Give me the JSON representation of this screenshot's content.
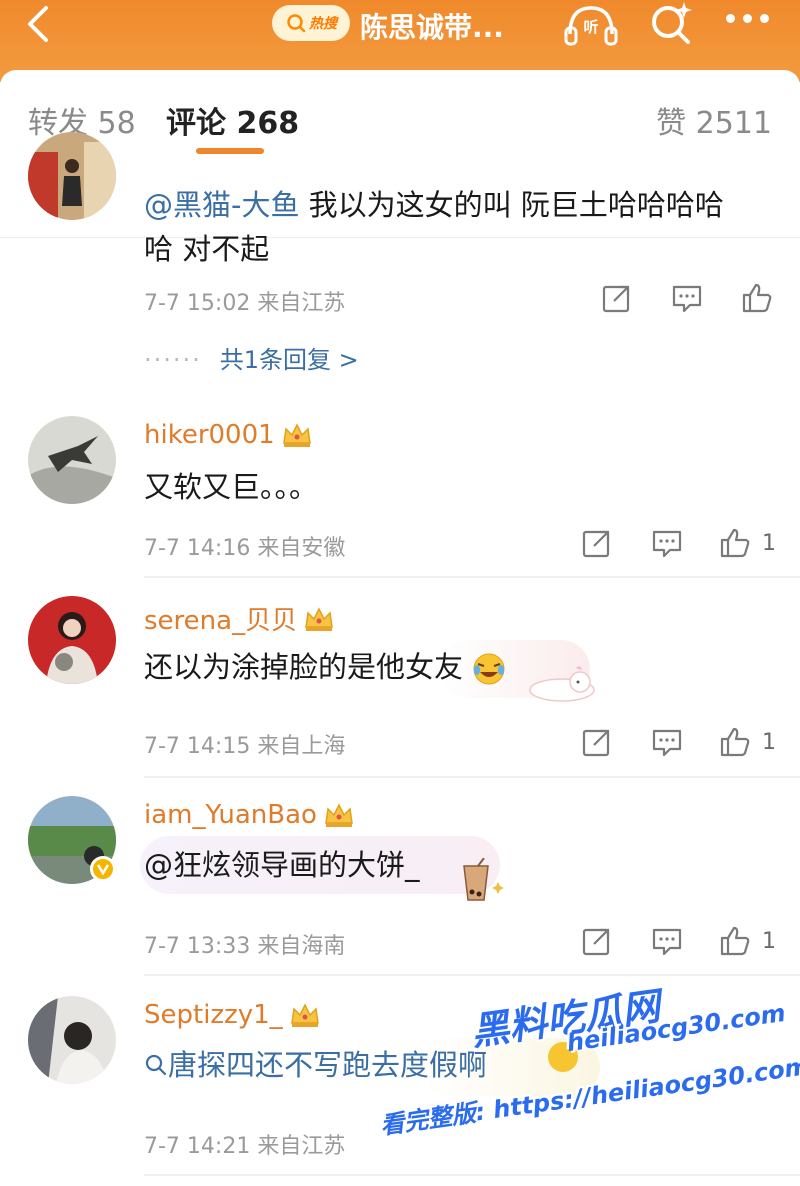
{
  "header": {
    "hot_tag": "热搜",
    "topic": "陈思诚带...",
    "icons": [
      "back-icon",
      "search-icon",
      "listen-icon",
      "ai-search-icon",
      "more-icon"
    ]
  },
  "tabs": {
    "repost": "转发 58",
    "comment": "评论 268",
    "like": "赞 2511"
  },
  "colors": {
    "accent": "#f0862b",
    "username": "#e07b2a",
    "mention": "#3a6ea5",
    "meta": "#9a9a9a"
  },
  "comments": [
    {
      "mention": "@黑猫-大鱼",
      "line1": " 我以为这女的叫 阮巨土哈哈哈哈",
      "line2": "哈 对不起",
      "meta": "7-7 15:02 来自江苏",
      "replies": "共1条回复 >",
      "replies_dots": "······"
    },
    {
      "username": "hiker0001",
      "text": "又软又巨。。。",
      "meta": "7-7 14:16 来自安徽",
      "likes": "1"
    },
    {
      "username": "serena_贝贝",
      "text": "还以为涂掉脸的是他女友",
      "meta": "7-7 14:15 来自上海",
      "likes": "1"
    },
    {
      "username": "iam_YuanBao",
      "text": "@狂炫领导画的大饼_",
      "meta": "7-7 13:33 来自海南",
      "likes": "1"
    },
    {
      "username": "Septizzy1_",
      "text": "唐探四还不写跑去度假啊",
      "meta": "7-7 14:21 来自江苏"
    }
  ],
  "watermark": {
    "title": "黑料吃瓜网",
    "domain": "heiliaocg30.com",
    "line": "看完整版: https://heiliaocg30.com"
  }
}
